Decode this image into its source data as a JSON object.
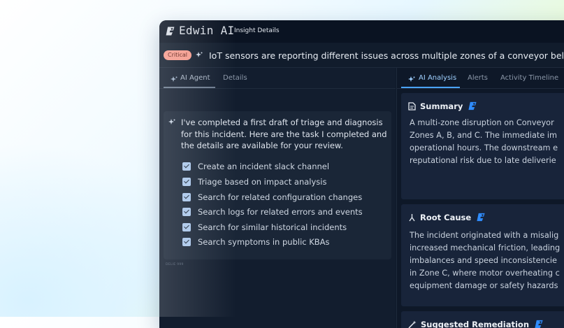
{
  "app": {
    "name": "Edwin AI",
    "window_title": "Insight Details"
  },
  "incident": {
    "severity": "Critical",
    "title": "IoT sensors are reporting different issues across multiple zones of a conveyor belt"
  },
  "left_tabs": [
    {
      "label": "AI Agent",
      "active": true
    },
    {
      "label": "Details",
      "active": false
    }
  ],
  "agent_message": {
    "text": "I've completed a first draft of triage and diagnosis for this incident. Here are the task I completed and the details are available for your review.",
    "tasks": [
      "Create an incident slack channel",
      "Triage based on impact analysis",
      "Search for related configuration changes",
      "Search logs for related errors and events",
      "Search for similar historical incidents",
      "Search symptoms in public KBAs"
    ],
    "footer_label": "DELIE 999"
  },
  "right_tabs": [
    {
      "label": "AI Analysis",
      "active": true
    },
    {
      "label": "Alerts",
      "active": false
    },
    {
      "label": "Activity Timeline",
      "active": false
    }
  ],
  "summary": {
    "title": "Summary",
    "lines": [
      "A multi-zone disruption on Conveyor",
      "Zones A, B, and C. The immediate im",
      "operational hours. The downstream e",
      "reputational risk due to late deliverie"
    ]
  },
  "root_cause": {
    "title": "Root Cause",
    "lines": [
      "The incident originated with a misalig",
      "increased mechanical friction, leading",
      "imbalances and speed inconsistencie",
      "in Zone C, where motor overheating c",
      "equipment damage or safety hazards"
    ]
  },
  "remediation": {
    "title": "Suggested Remediation"
  },
  "colors": {
    "badge": "#f49a8c",
    "accent_blue": "#4aa3ff",
    "panel_dark": "#0f1a2a",
    "logo_blue": "#2f8cff"
  }
}
